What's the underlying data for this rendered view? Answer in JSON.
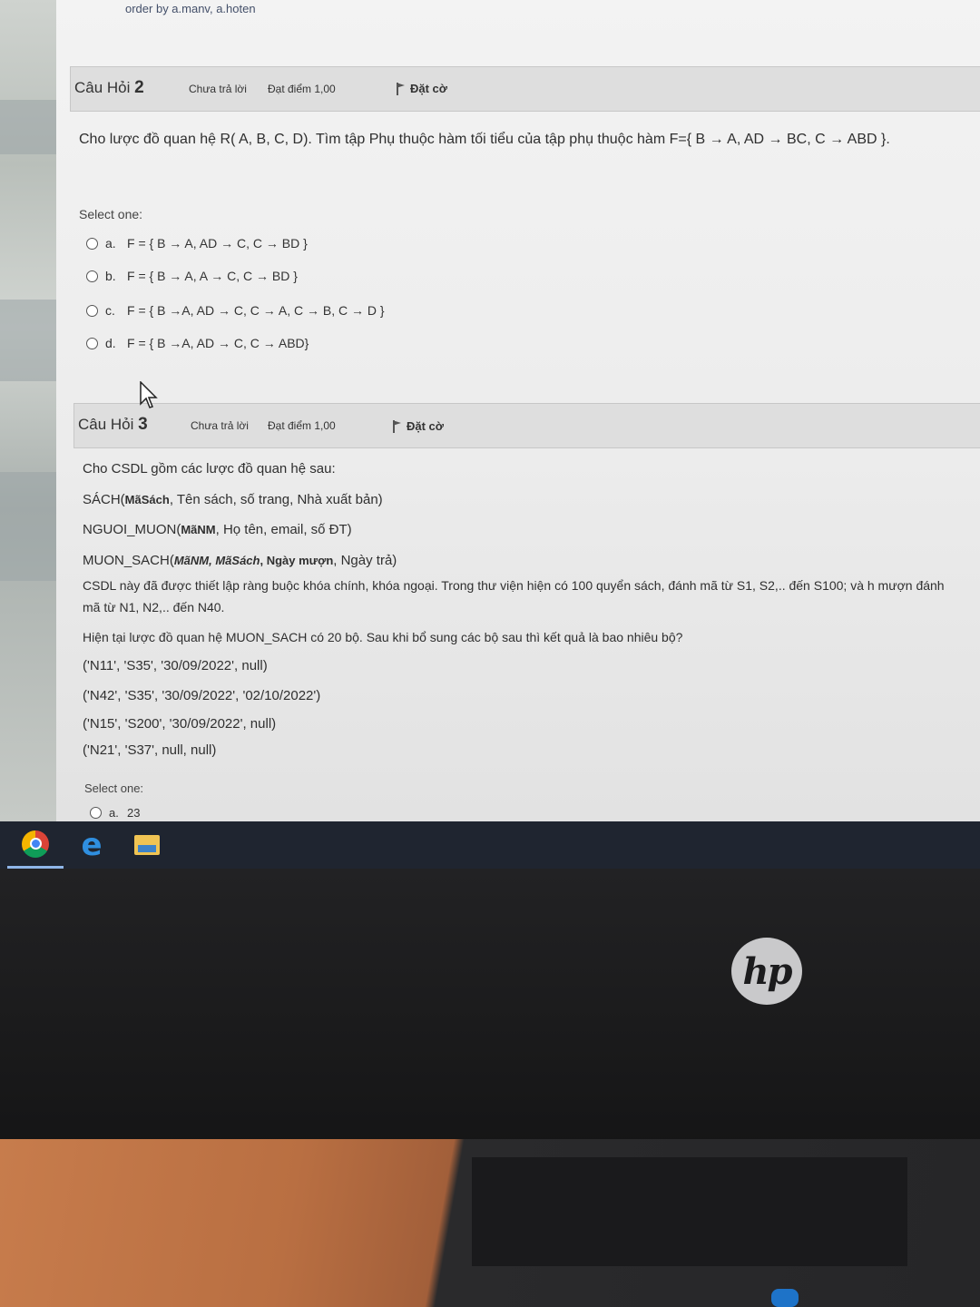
{
  "page": {
    "meta_text": "order by a.manv, a.hoten"
  },
  "question2": {
    "title_prefix": "Câu Hỏi",
    "number": "2",
    "status": "Chưa trả lời",
    "grade": "Đạt điểm 1,00",
    "flag_label": "Đặt cờ",
    "text": "Cho lược đồ quan hệ R( A, B, C, D). Tìm tập Phụ thuộc hàm tối tiểu của tập phụ thuộc hàm F={ B → A, AD → BC, C → ABD }.",
    "select_label": "Select one:",
    "options": [
      {
        "letter": "a.",
        "text": "F = { B → A, AD → C, C → BD }"
      },
      {
        "letter": "b.",
        "text": "F = { B → A, A → C, C → BD }"
      },
      {
        "letter": "c.",
        "text": "F = { B →A, AD → C, C → A, C → B, C → D }"
      },
      {
        "letter": "d.",
        "text": "F = { B →A, AD → C,  C → ABD}"
      }
    ]
  },
  "question3": {
    "title_prefix": "Câu Hỏi",
    "number": "3",
    "status": "Chưa trả lời",
    "grade": "Đạt điểm 1,00",
    "flag_label": "Đặt cờ",
    "intro": "Cho CSDL gồm các lược đồ quan hệ sau:",
    "schemas": [
      {
        "name": "SÁCH(",
        "keys": "MãSách",
        "rest": ", Tên sách, số trang, Nhà xuất bản)"
      },
      {
        "name": "NGUOI_MUON(",
        "keys": "MãNM",
        "rest": ", Họ tên, email, số ĐT)"
      },
      {
        "name": "MUON_SACH(",
        "keys": "MãNM, MãSách",
        "mid": ", Ngày mượn",
        "rest": ", Ngày trả)"
      }
    ],
    "constraint_text": "CSDL này đã được thiết lập ràng buộc khóa chính, khóa ngoại. Trong thư viện hiện có 100 quyển sách, đánh mã từ S1, S2,.. đến S100; và h mượn đánh mã từ N1, N2,.. đến N40.",
    "question": "Hiện tại lược đồ quan hệ MUON_SACH có 20 bộ. Sau khi bổ sung các bộ sau thì kết quả là bao nhiêu bộ?",
    "tuples": [
      "('N11', 'S35', '30/09/2022', null)",
      "('N42', 'S35', '30/09/2022', '02/10/2022')",
      "('N15', 'S200', '30/09/2022', null)",
      "('N21', 'S37', null, null)"
    ],
    "select_label": "Select one:",
    "options": [
      {
        "letter": "a.",
        "text": "23"
      }
    ]
  },
  "taskbar": {
    "apps": [
      {
        "icon": "chrome-icon"
      },
      {
        "icon": "edge-icon"
      },
      {
        "icon": "file-explorer-icon"
      }
    ]
  },
  "monitor": {
    "brand": "hp"
  }
}
